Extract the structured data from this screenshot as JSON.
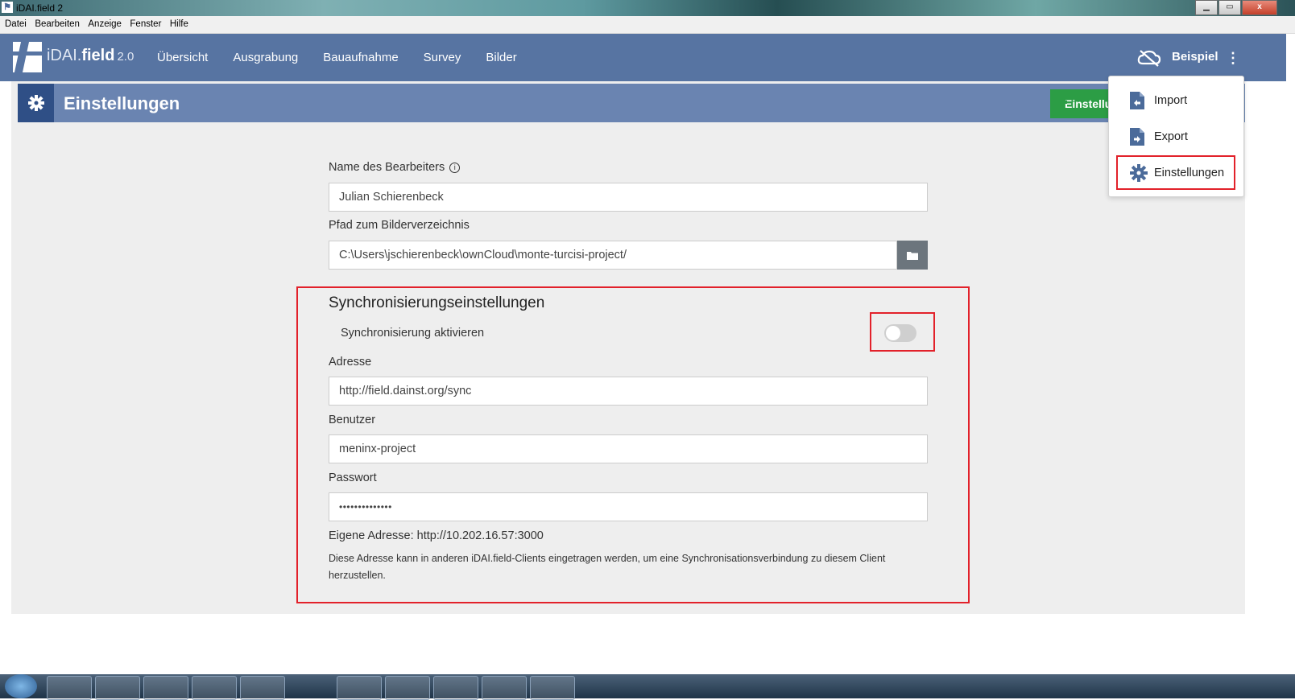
{
  "window": {
    "title": "iDAI.field 2",
    "buttons": {
      "minimize": "▁",
      "maximize": "▭",
      "close": "x"
    }
  },
  "menubar": {
    "items": [
      "Datei",
      "Bearbeiten",
      "Anzeige",
      "Fenster",
      "Hilfe"
    ]
  },
  "navbar": {
    "brand": {
      "prefix": "iDAI.",
      "name": "field",
      "version": "2.0"
    },
    "links": [
      "Übersicht",
      "Ausgrabung",
      "Bauaufnahme",
      "Survey",
      "Bilder"
    ],
    "project": "Beispiel",
    "sync_icon": "cloud-off-icon",
    "menu_icon": "kebab-menu-icon"
  },
  "header": {
    "icon": "gear-icon",
    "title": "Einstellungen",
    "save_label": "Einstellungen speichern"
  },
  "form": {
    "editor_label": "Name des Bearbeiters",
    "editor_value": "Julian Schierenbeck",
    "path_label": "Pfad zum Bilderverzeichnis",
    "path_value": "C:\\Users\\jschierenbeck\\ownCloud\\monte-turcisi-project/",
    "sync": {
      "title": "Synchronisierungseinstellungen",
      "activate_label": "Synchronisierung aktivieren",
      "activated": false,
      "address_label": "Adresse",
      "address_value": "http://field.dainst.org/sync",
      "user_label": "Benutzer",
      "user_value": "meninx-project",
      "password_label": "Passwort",
      "password_value": "••••••••••••••",
      "own_address": "Eigene Adresse: http://10.202.16.57:3000",
      "hint": "Diese Adresse kann in anderen iDAI.field-Clients eingetragen werden, um eine Synchronisationsverbindung zu diesem Client herzustellen."
    }
  },
  "dropdown": {
    "items": [
      {
        "label": "Import",
        "icon": "file-import-icon"
      },
      {
        "label": "Export",
        "icon": "file-export-icon"
      },
      {
        "label": "Einstellungen",
        "icon": "gear-icon"
      }
    ]
  },
  "colors": {
    "navbar": "#5774a2",
    "header": "#6a84b1",
    "header_icon_bg": "#2f4f86",
    "save_button": "#2c9d45",
    "highlight": "#e2212a"
  }
}
